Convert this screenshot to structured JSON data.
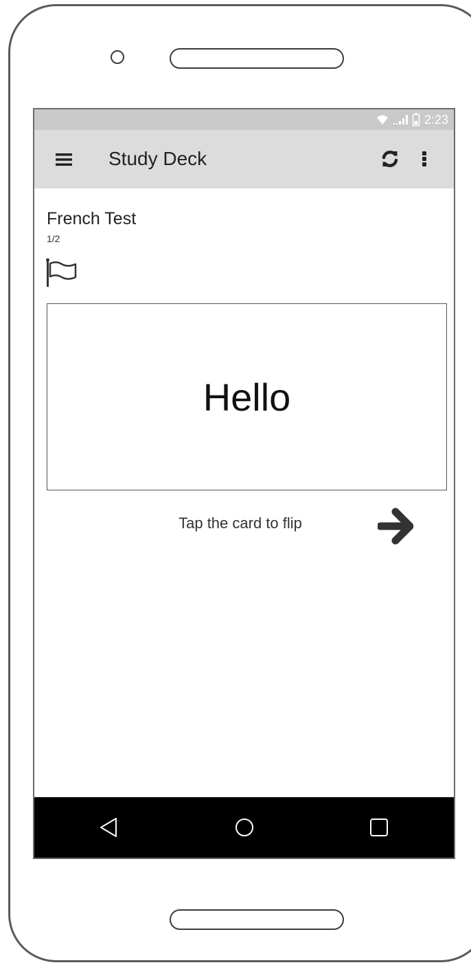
{
  "status_bar": {
    "time": "2:23",
    "icons": [
      "wifi-icon",
      "signal-icon",
      "battery-icon"
    ]
  },
  "app_bar": {
    "title": "Study Deck",
    "icons": [
      "menu-icon",
      "refresh-icon",
      "more-vert-icon"
    ]
  },
  "deck": {
    "title": "French Test",
    "progress": "1/2",
    "flag_icon": "flag-icon"
  },
  "card": {
    "text": "Hello"
  },
  "hint": "Tap the card to flip",
  "next_icon": "arrow-right-icon",
  "nav_bar": {
    "icons": [
      "back-icon",
      "home-icon",
      "recents-icon"
    ]
  },
  "colors": {
    "status_bar": "#c9c9c9",
    "app_bar": "#dcdcdc",
    "nav_bar": "#000000",
    "icon": "#333333"
  }
}
